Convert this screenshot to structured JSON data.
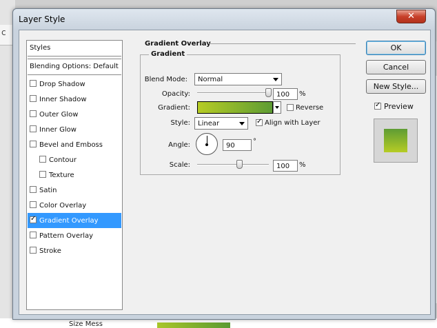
{
  "background": {
    "bottom_text": "Size Mess",
    "left_glyph": "c"
  },
  "dialog": {
    "title": "Layer Style",
    "close_label": "✕",
    "buttons": {
      "ok": "OK",
      "cancel": "Cancel",
      "new_style": "New Style...",
      "preview": "Preview"
    },
    "preview_checked": true
  },
  "styles_list": {
    "header": "Styles",
    "blending_default": "Blending Options: Default",
    "items": [
      {
        "label": "Drop Shadow",
        "checked": false,
        "sub": false,
        "selected": false
      },
      {
        "label": "Inner Shadow",
        "checked": false,
        "sub": false,
        "selected": false
      },
      {
        "label": "Outer Glow",
        "checked": false,
        "sub": false,
        "selected": false
      },
      {
        "label": "Inner Glow",
        "checked": false,
        "sub": false,
        "selected": false
      },
      {
        "label": "Bevel and Emboss",
        "checked": false,
        "sub": false,
        "selected": false
      },
      {
        "label": "Contour",
        "checked": false,
        "sub": true,
        "selected": false
      },
      {
        "label": "Texture",
        "checked": false,
        "sub": true,
        "selected": false
      },
      {
        "label": "Satin",
        "checked": false,
        "sub": false,
        "selected": false
      },
      {
        "label": "Color Overlay",
        "checked": false,
        "sub": false,
        "selected": false
      },
      {
        "label": "Gradient Overlay",
        "checked": true,
        "sub": false,
        "selected": true
      },
      {
        "label": "Pattern Overlay",
        "checked": false,
        "sub": false,
        "selected": false
      },
      {
        "label": "Stroke",
        "checked": false,
        "sub": false,
        "selected": false
      }
    ]
  },
  "gradient_overlay": {
    "section_title": "Gradient Overlay",
    "group_title": "Gradient",
    "blend_mode_label": "Blend Mode:",
    "blend_mode_value": "Normal",
    "opacity_label": "Opacity:",
    "opacity_value": "100",
    "opacity_unit": "%",
    "opacity_level": 1.0,
    "gradient_label": "Gradient:",
    "gradient_colors": [
      "#b6cc25",
      "#5e9c34"
    ],
    "reverse_label": "Reverse",
    "reverse_checked": false,
    "style_label": "Style:",
    "style_value": "Linear",
    "align_label": "Align with Layer",
    "align_checked": true,
    "angle_label": "Angle:",
    "angle_value": "90",
    "angle_unit": "°",
    "scale_label": "Scale:",
    "scale_value": "100",
    "scale_unit": "%",
    "scale_level": 0.6
  },
  "colors": {
    "selection": "#3399ff",
    "close_button": "#c7402a"
  }
}
